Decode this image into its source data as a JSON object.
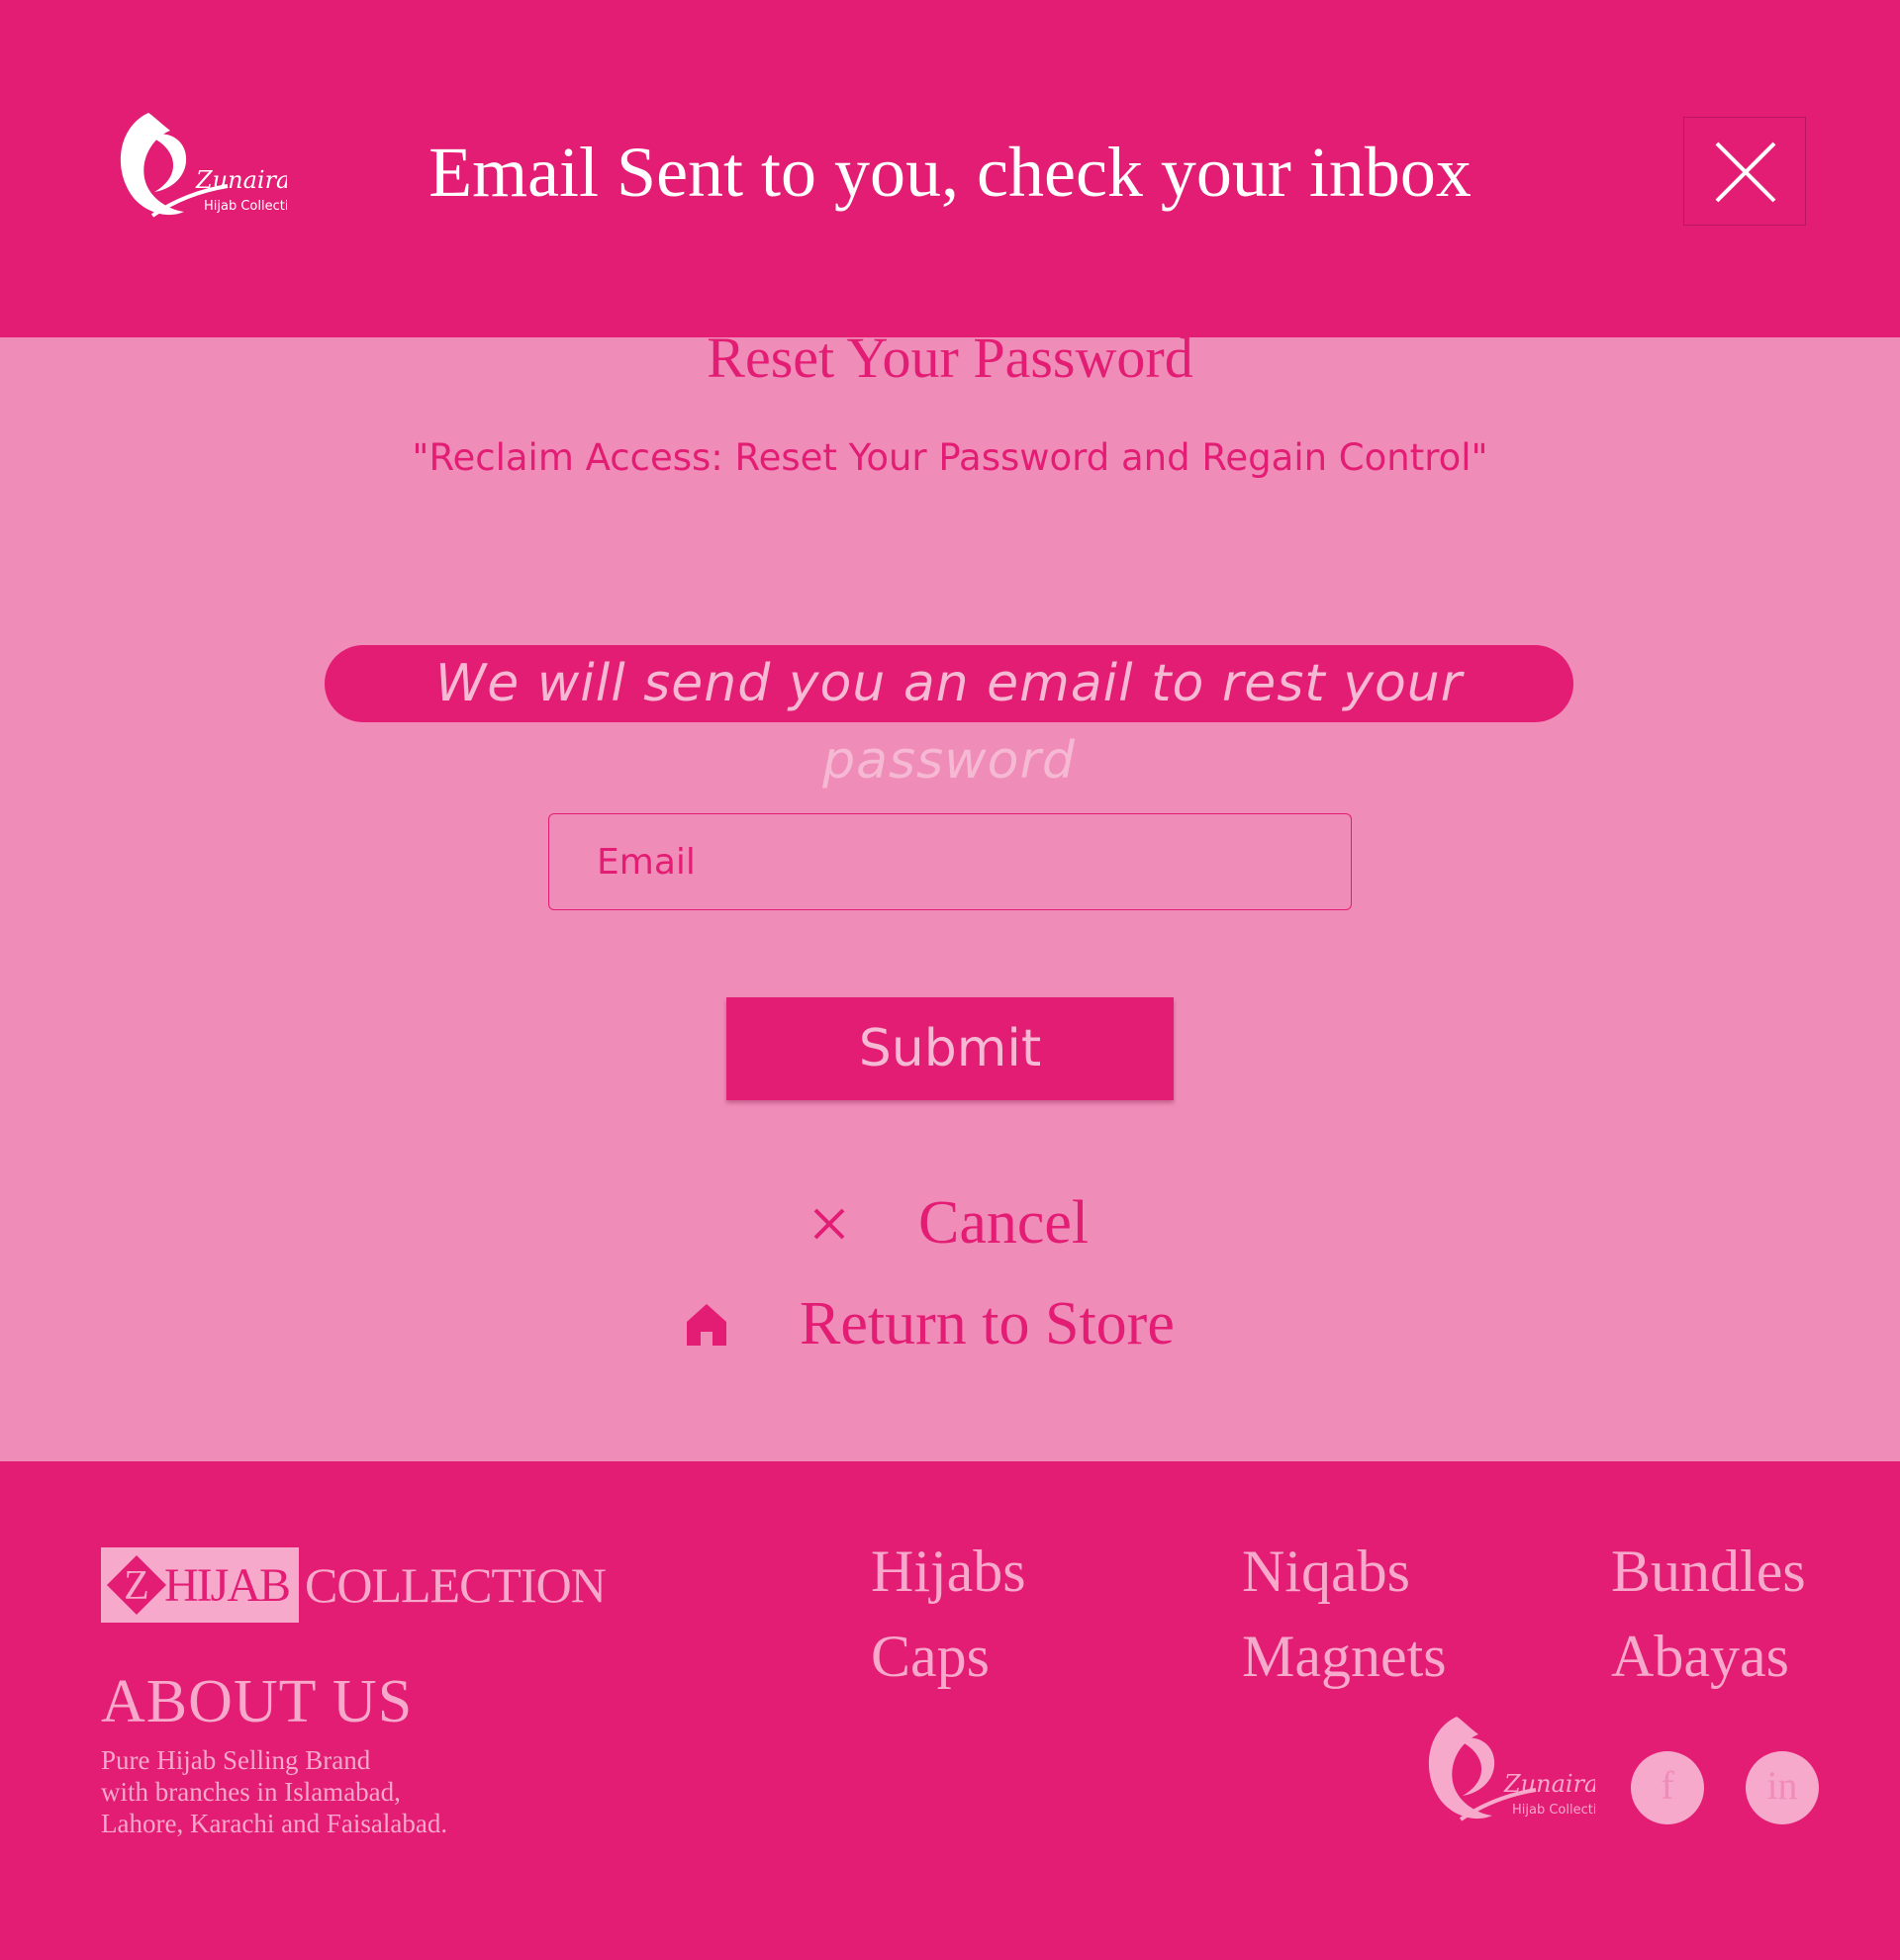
{
  "notification": {
    "message": "Email Sent to you, check your inbox",
    "logo": {
      "icon": "zunaira-logo-icon",
      "script_text": "Zunaira",
      "tagline": "Hijab Collection"
    },
    "close_icon": "close-icon"
  },
  "reset": {
    "title": "Reset Your Password",
    "subtitle": "\"Reclaim Access: Reset Your Password and Regain Control\"",
    "info": "We will send you an email to rest your password",
    "email_placeholder": "Email",
    "email_value": "",
    "submit_label": "Submit",
    "cancel_label": "Cancel",
    "cancel_icon": "x-icon",
    "return_label": "Return to Store",
    "return_icon": "home-icon"
  },
  "footer": {
    "brand": {
      "letter": "Z",
      "hijab": "HIJAB",
      "collection": "COLLECTION"
    },
    "about_title": "ABOUT US",
    "about_lines": [
      "Pure Hijab Selling Brand",
      "with branches in Islamabad,",
      "Lahore, Karachi and Faisalabad."
    ],
    "links": [
      "Hijabs",
      "Niqabs",
      "Bundles",
      "Caps",
      "Magnets",
      "Abayas"
    ],
    "logo": {
      "icon": "zunaira-logo-icon",
      "script_text": "Zunaira",
      "tagline": "Hijab Collection"
    },
    "social": [
      {
        "name": "facebook-icon",
        "glyph": "f"
      },
      {
        "name": "linkedin-icon",
        "glyph": "in"
      }
    ]
  },
  "colors": {
    "brand_pink": "#e31c74",
    "background_pink": "#f08cb8",
    "light_pink": "#f6a9cb",
    "white": "#ffffff"
  }
}
